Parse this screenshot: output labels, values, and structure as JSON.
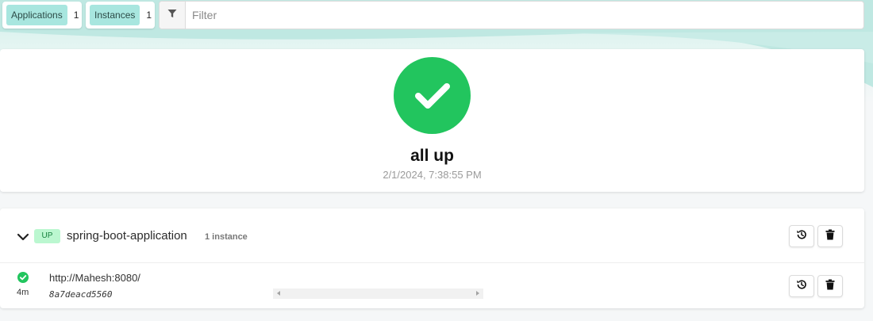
{
  "colors": {
    "accent_teal": "#a8e6df",
    "status_up_green": "#22c55e",
    "badge_up_bg": "#bbf7d0",
    "badge_up_text": "#15803d"
  },
  "topbar": {
    "applications_label": "Applications",
    "applications_count": "1",
    "instances_label": "Instances",
    "instances_count": "1",
    "filter_icon": "filter-icon",
    "filter_placeholder": "Filter",
    "filter_value": ""
  },
  "status": {
    "icon": "check-circle-icon",
    "text": "all up",
    "timestamp": "2/1/2024, 7:38:55 PM"
  },
  "application": {
    "expand_icon": "chevron-down-icon",
    "status_badge": "UP",
    "name": "spring-boot-application",
    "instance_count": "1 instance",
    "actions": [
      {
        "icon": "history-icon",
        "label": "Unregister history"
      },
      {
        "icon": "trash-icon",
        "label": "Delete"
      }
    ],
    "instances": [
      {
        "status_icon": "check-circle-icon",
        "age": "4m",
        "url": "http://Mahesh:8080/",
        "id": "8a7deacd5560",
        "actions": [
          {
            "icon": "history-icon"
          },
          {
            "icon": "trash-icon"
          }
        ]
      }
    ]
  }
}
